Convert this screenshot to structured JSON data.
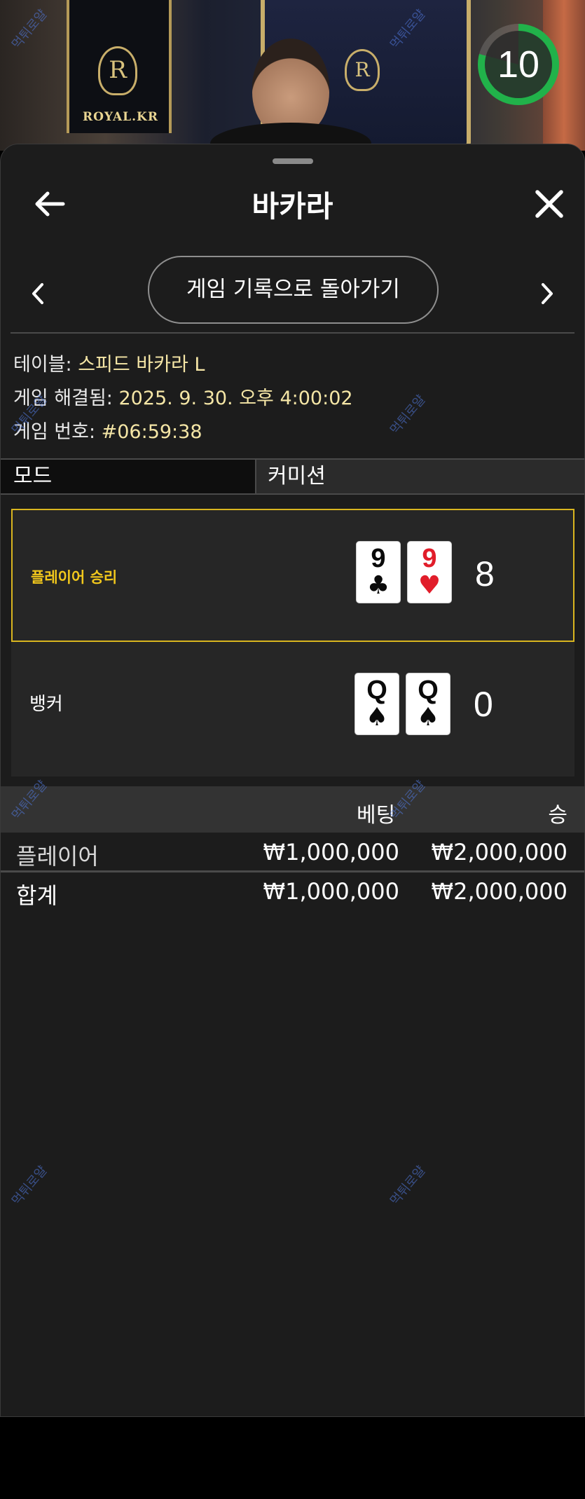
{
  "video": {
    "brand_label": "ROYAL.KR",
    "crest_letter": "R",
    "timer_value": "10",
    "timer_progress": 0.79
  },
  "header": {
    "title": "바카라",
    "back_icon": "arrow-left-icon",
    "close_icon": "close-icon"
  },
  "nav": {
    "back_to_history_label": "게임 기록으로 돌아가기",
    "prev_icon": "chevron-left-icon",
    "next_icon": "chevron-right-icon"
  },
  "info": {
    "table_label": "테이블: ",
    "table_value": "스피드 바카라 L",
    "resolved_label": "게임 해결됨: ",
    "resolved_value": "2025. 9. 30. 오후 4:00:02",
    "game_no_label": "게임 번호: ",
    "game_no_value": "#06:59:38"
  },
  "mode": {
    "mode_label": "모드",
    "mode_value": "커미션"
  },
  "hands": {
    "player": {
      "label": "플레이어 승리",
      "cards": [
        {
          "rank": "9",
          "suit": "♣",
          "color": "black"
        },
        {
          "rank": "9",
          "suit": "♥",
          "color": "red"
        }
      ],
      "score": "8"
    },
    "banker": {
      "label": "뱅커",
      "cards": [
        {
          "rank": "Q",
          "suit": "♠",
          "color": "black"
        },
        {
          "rank": "Q",
          "suit": "♠",
          "color": "black"
        }
      ],
      "score": "0"
    }
  },
  "bets": {
    "header_bet": "베팅",
    "header_win": "승",
    "rows": [
      {
        "name": "플레이어",
        "bet": "₩1,000,000",
        "win": "₩2,000,000"
      }
    ],
    "total": {
      "name": "합계",
      "bet": "₩1,000,000",
      "win": "₩2,000,000"
    }
  },
  "watermark_text": "먹튀로얄",
  "colors": {
    "accent_gold": "#d9b51f",
    "player_win_text": "#f2c81c",
    "timer_green": "#21b24a",
    "info_value": "#f5e6a6"
  }
}
